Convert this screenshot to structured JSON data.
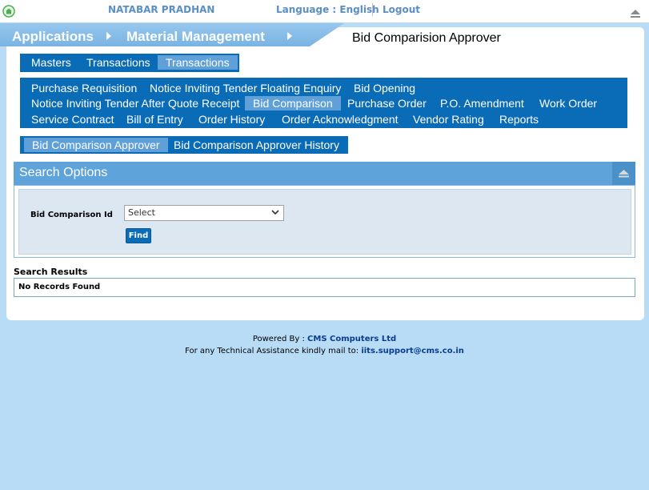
{
  "topbar": {
    "user_name": "NATABAR PRADHAN",
    "language": "Language : English",
    "logout": "Logout"
  },
  "breadcrumb": {
    "items": [
      "Applications",
      "Material Management"
    ],
    "page_title": "Bid Comparision Approver"
  },
  "menu_level1": {
    "items": [
      "Masters",
      "Transactions",
      "Transactions"
    ],
    "selected_index": 2
  },
  "menu_level2": {
    "items": [
      "Purchase Requisition",
      "Notice Inviting Tender Floating Enquiry",
      "Bid Opening",
      "Notice Inviting Tender After Quote Receipt",
      "Bid Comparison",
      "Purchase Order",
      "P.O. Amendment",
      "Work Order",
      "Service Contract",
      "Bill of Entry",
      "Order History",
      "Order Acknowledgment",
      "Vendor Rating",
      "Reports"
    ],
    "selected": "Bid Comparison"
  },
  "menu_level3": {
    "items": [
      "Bid Comparison Approver",
      "Bid Comparison Approver History"
    ],
    "selected": "Bid Comparison Approver"
  },
  "search": {
    "title": "Search Options",
    "field_label": "Bid Comparison Id",
    "select_value": "Select",
    "find_label": "Find"
  },
  "results": {
    "label": "Search Results",
    "message": "No Records Found"
  },
  "footer": {
    "powered_prefix": "Powered By : ",
    "powered_company": "CMS Computers Ltd",
    "support_prefix": "For any Technical Assistance kindly mail to: ",
    "support_email": "iits.support@cms.co.in"
  },
  "colors": {
    "page_bg": "#b8dbf6",
    "menu_bg": "#0a6cb7",
    "menu_selected": "#5ea0d7",
    "header_text": "#5b8fc4"
  },
  "icons": [
    "home-icon",
    "collapse-up-icon",
    "chevron-right-icon",
    "chevron-down-icon"
  ]
}
